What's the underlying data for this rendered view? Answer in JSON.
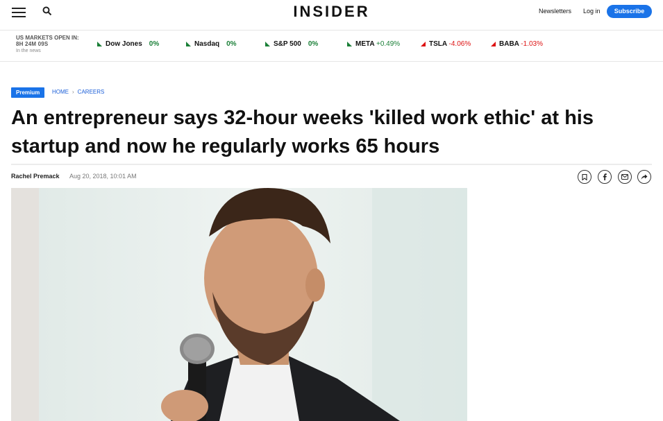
{
  "header": {
    "logo": "INSIDER",
    "newsletters": "Newsletters",
    "login": "Log in",
    "subscribe": "Subscribe"
  },
  "markets": {
    "status": "US MARKETS OPEN IN:",
    "countdown": "8H 24M 09S",
    "note": "In the news",
    "tickers": [
      {
        "name": "Dow Jones",
        "change": "0%",
        "direction": "flat"
      },
      {
        "name": "Nasdaq",
        "change": "0%",
        "direction": "flat"
      },
      {
        "name": "S&P 500",
        "change": "0%",
        "direction": "flat"
      },
      {
        "name": "META",
        "change": "+0.49%",
        "direction": "up"
      },
      {
        "name": "TSLA",
        "change": "-4.06%",
        "direction": "down"
      },
      {
        "name": "BABA",
        "change": "-1.03%",
        "direction": "down"
      }
    ]
  },
  "article": {
    "badge": "Premium",
    "breadcrumb": [
      "HOME",
      "CAREERS"
    ],
    "breadcrumb_sep": "›",
    "headline": "An entrepreneur says 32-hour weeks 'killed work ethic' at his startup and now he regularly works 65 hours",
    "author": "Rachel Premack",
    "date": "Aug 20, 2018, 10:01 AM"
  },
  "share_icons": [
    "bookmark-icon",
    "facebook-icon",
    "email-icon",
    "share-icon"
  ],
  "colors": {
    "accent": "#1a73e8",
    "positive": "#1a7f37",
    "negative": "#dd1111"
  }
}
